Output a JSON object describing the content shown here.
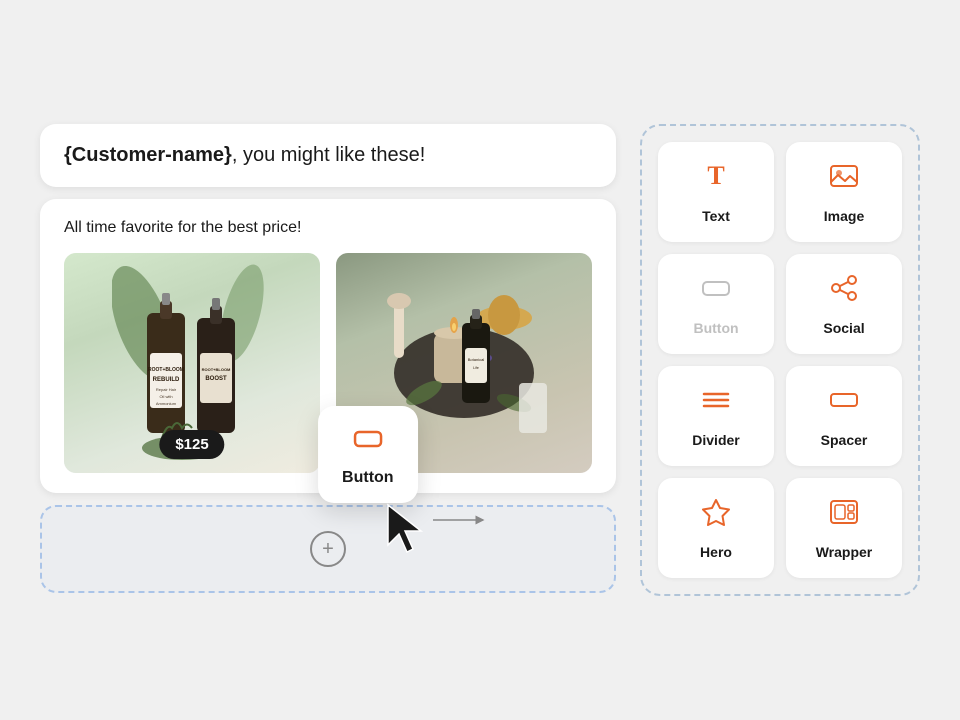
{
  "header": {
    "text_bold": "{Customer-name}",
    "text_regular": ", you might like these!"
  },
  "content": {
    "subtitle": "All time favorite for the best price!",
    "product1": {
      "price": "$125"
    },
    "product2": {}
  },
  "drop_zone": {
    "add_icon": "+"
  },
  "floating_button": {
    "label": "Button"
  },
  "widgets": [
    {
      "id": "text",
      "label": "Text",
      "icon": "text",
      "muted": false
    },
    {
      "id": "image",
      "label": "Image",
      "icon": "image",
      "muted": false
    },
    {
      "id": "button",
      "label": "Button",
      "icon": "button",
      "muted": true
    },
    {
      "id": "social",
      "label": "Social",
      "icon": "social",
      "muted": false
    },
    {
      "id": "divider",
      "label": "Divider",
      "icon": "divider",
      "muted": false
    },
    {
      "id": "spacer",
      "label": "Spacer",
      "icon": "spacer",
      "muted": false
    },
    {
      "id": "hero",
      "label": "Hero",
      "icon": "hero",
      "muted": false
    },
    {
      "id": "wrapper",
      "label": "Wrapper",
      "icon": "wrapper",
      "muted": false
    }
  ],
  "colors": {
    "accent": "#E8652A",
    "dashed_border": "#b0c4d8",
    "muted": "#c0c0c0"
  }
}
